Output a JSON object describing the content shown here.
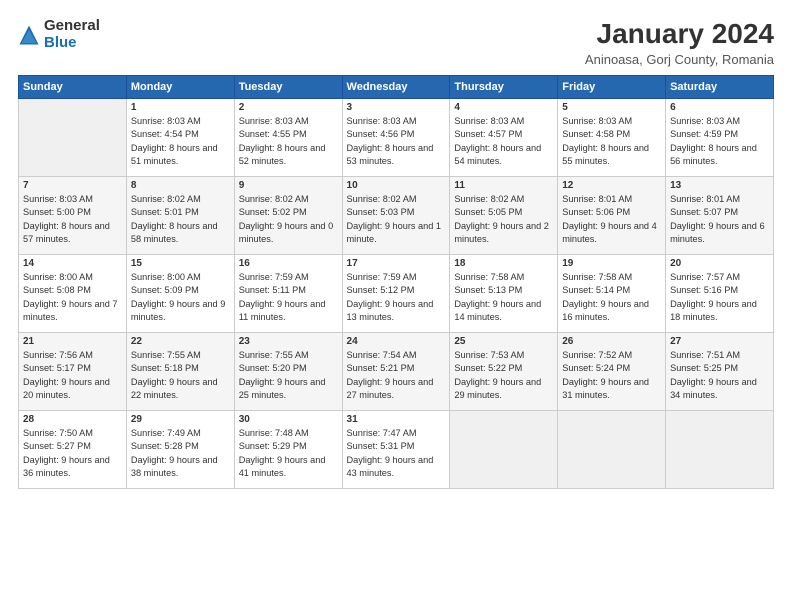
{
  "logo": {
    "general": "General",
    "blue": "Blue"
  },
  "header": {
    "title": "January 2024",
    "location": "Aninoasa, Gorj County, Romania"
  },
  "weekdays": [
    "Sunday",
    "Monday",
    "Tuesday",
    "Wednesday",
    "Thursday",
    "Friday",
    "Saturday"
  ],
  "weeks": [
    [
      {
        "day": "",
        "empty": true
      },
      {
        "day": "1",
        "sunrise": "8:03 AM",
        "sunset": "4:54 PM",
        "daylight": "8 hours and 51 minutes."
      },
      {
        "day": "2",
        "sunrise": "8:03 AM",
        "sunset": "4:55 PM",
        "daylight": "8 hours and 52 minutes."
      },
      {
        "day": "3",
        "sunrise": "8:03 AM",
        "sunset": "4:56 PM",
        "daylight": "8 hours and 53 minutes."
      },
      {
        "day": "4",
        "sunrise": "8:03 AM",
        "sunset": "4:57 PM",
        "daylight": "8 hours and 54 minutes."
      },
      {
        "day": "5",
        "sunrise": "8:03 AM",
        "sunset": "4:58 PM",
        "daylight": "8 hours and 55 minutes."
      },
      {
        "day": "6",
        "sunrise": "8:03 AM",
        "sunset": "4:59 PM",
        "daylight": "8 hours and 56 minutes."
      }
    ],
    [
      {
        "day": "7",
        "sunrise": "8:03 AM",
        "sunset": "5:00 PM",
        "daylight": "8 hours and 57 minutes."
      },
      {
        "day": "8",
        "sunrise": "8:02 AM",
        "sunset": "5:01 PM",
        "daylight": "8 hours and 58 minutes."
      },
      {
        "day": "9",
        "sunrise": "8:02 AM",
        "sunset": "5:02 PM",
        "daylight": "9 hours and 0 minutes."
      },
      {
        "day": "10",
        "sunrise": "8:02 AM",
        "sunset": "5:03 PM",
        "daylight": "9 hours and 1 minute."
      },
      {
        "day": "11",
        "sunrise": "8:02 AM",
        "sunset": "5:05 PM",
        "daylight": "9 hours and 2 minutes."
      },
      {
        "day": "12",
        "sunrise": "8:01 AM",
        "sunset": "5:06 PM",
        "daylight": "9 hours and 4 minutes."
      },
      {
        "day": "13",
        "sunrise": "8:01 AM",
        "sunset": "5:07 PM",
        "daylight": "9 hours and 6 minutes."
      }
    ],
    [
      {
        "day": "14",
        "sunrise": "8:00 AM",
        "sunset": "5:08 PM",
        "daylight": "9 hours and 7 minutes."
      },
      {
        "day": "15",
        "sunrise": "8:00 AM",
        "sunset": "5:09 PM",
        "daylight": "9 hours and 9 minutes."
      },
      {
        "day": "16",
        "sunrise": "7:59 AM",
        "sunset": "5:11 PM",
        "daylight": "9 hours and 11 minutes."
      },
      {
        "day": "17",
        "sunrise": "7:59 AM",
        "sunset": "5:12 PM",
        "daylight": "9 hours and 13 minutes."
      },
      {
        "day": "18",
        "sunrise": "7:58 AM",
        "sunset": "5:13 PM",
        "daylight": "9 hours and 14 minutes."
      },
      {
        "day": "19",
        "sunrise": "7:58 AM",
        "sunset": "5:14 PM",
        "daylight": "9 hours and 16 minutes."
      },
      {
        "day": "20",
        "sunrise": "7:57 AM",
        "sunset": "5:16 PM",
        "daylight": "9 hours and 18 minutes."
      }
    ],
    [
      {
        "day": "21",
        "sunrise": "7:56 AM",
        "sunset": "5:17 PM",
        "daylight": "9 hours and 20 minutes."
      },
      {
        "day": "22",
        "sunrise": "7:55 AM",
        "sunset": "5:18 PM",
        "daylight": "9 hours and 22 minutes."
      },
      {
        "day": "23",
        "sunrise": "7:55 AM",
        "sunset": "5:20 PM",
        "daylight": "9 hours and 25 minutes."
      },
      {
        "day": "24",
        "sunrise": "7:54 AM",
        "sunset": "5:21 PM",
        "daylight": "9 hours and 27 minutes."
      },
      {
        "day": "25",
        "sunrise": "7:53 AM",
        "sunset": "5:22 PM",
        "daylight": "9 hours and 29 minutes."
      },
      {
        "day": "26",
        "sunrise": "7:52 AM",
        "sunset": "5:24 PM",
        "daylight": "9 hours and 31 minutes."
      },
      {
        "day": "27",
        "sunrise": "7:51 AM",
        "sunset": "5:25 PM",
        "daylight": "9 hours and 34 minutes."
      }
    ],
    [
      {
        "day": "28",
        "sunrise": "7:50 AM",
        "sunset": "5:27 PM",
        "daylight": "9 hours and 36 minutes."
      },
      {
        "day": "29",
        "sunrise": "7:49 AM",
        "sunset": "5:28 PM",
        "daylight": "9 hours and 38 minutes."
      },
      {
        "day": "30",
        "sunrise": "7:48 AM",
        "sunset": "5:29 PM",
        "daylight": "9 hours and 41 minutes."
      },
      {
        "day": "31",
        "sunrise": "7:47 AM",
        "sunset": "5:31 PM",
        "daylight": "9 hours and 43 minutes."
      },
      {
        "day": "",
        "empty": true
      },
      {
        "day": "",
        "empty": true
      },
      {
        "day": "",
        "empty": true
      }
    ]
  ],
  "labels": {
    "sunrise_prefix": "Sunrise: ",
    "sunset_prefix": "Sunset: ",
    "daylight_prefix": "Daylight: "
  }
}
